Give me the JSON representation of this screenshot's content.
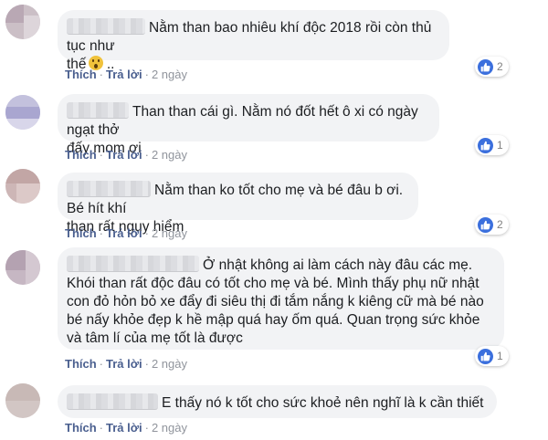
{
  "comments": [
    {
      "text": "Nằm than bao nhiêu khí độc 2018 rồi còn thủ tục như\nthế",
      "emoji_name": "face-screaming-icon",
      "suffix": " ..",
      "like_label": "Thích",
      "reply_label": "Trả lời",
      "time": "2 ngày",
      "reactions": "2"
    },
    {
      "text": "Than than cái gì. Nằm nó đốt hết ô xi có ngày ngạt thở\nđấy mom ơi",
      "like_label": "Thích",
      "reply_label": "Trả lời",
      "time": "2 ngày",
      "reactions": "1"
    },
    {
      "text": "Nằm than ko tốt cho mẹ và bé đâu b ơi. Bé hít khí\nthan rất nguy hiểm",
      "like_label": "Thích",
      "reply_label": "Trả lời",
      "time": "2 ngày",
      "reactions": "2"
    },
    {
      "text": "Ở nhật không ai làm cách này đâu các mẹ.\nKhói than rất độc đâu có tốt cho mẹ và bé. Mình thấy phụ nữ nhật\ncon đỏ hỏn bỏ xe đẩy đi siêu thị đi tắm nắng k kiêng cữ mà bé nào\nbé nấy khỏe đẹp k hề mập quá hay ốm quá. Quan trọng sức khỏe\nvà tâm lí của mẹ tốt là được",
      "like_label": "Thích",
      "reply_label": "Trả lời",
      "time": "2 ngày",
      "reactions": "1"
    },
    {
      "text": "E thấy nó k tốt cho sức khoẻ nên nghĩ là k cần thiết",
      "like_label": "Thích",
      "reply_label": "Trả lời",
      "time": "2 ngày"
    }
  ],
  "colors": {
    "bubble": "#f2f3f5",
    "link": "#4a5f8f",
    "like_blue": "#3b6fdd"
  },
  "icons": {
    "like": "thumbs-up-icon"
  }
}
